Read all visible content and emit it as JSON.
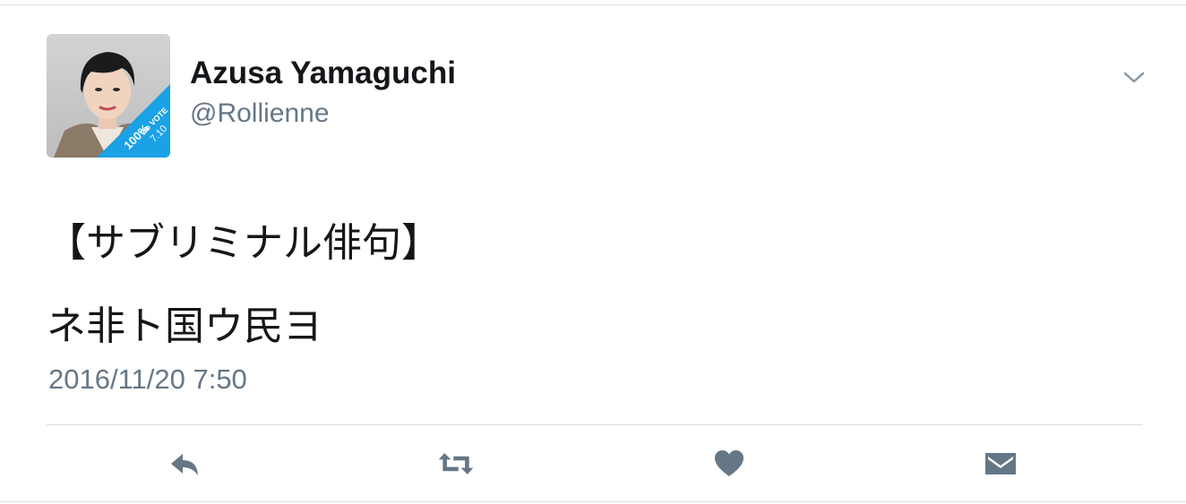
{
  "tweet": {
    "display_name": "Azusa Yamaguchi",
    "handle": "@Rollienne",
    "text_lines": [
      "【サブリミナル俳句】",
      "ネ非ト国ウ民ヨ"
    ],
    "timestamp": "2016/11/20 7:50",
    "avatar_badge": {
      "line1": "100%",
      "line2": "Go VOTE",
      "line3": "7.10"
    }
  },
  "icons": {
    "menu": "chevron-down-icon",
    "reply": "reply-icon",
    "retweet": "retweet-icon",
    "like": "heart-icon",
    "dm": "envelope-icon"
  },
  "colors": {
    "icon": "#657786",
    "text": "#14171a",
    "muted": "#657786",
    "divider": "#d9dde1",
    "badge": "#1aa1e6"
  }
}
